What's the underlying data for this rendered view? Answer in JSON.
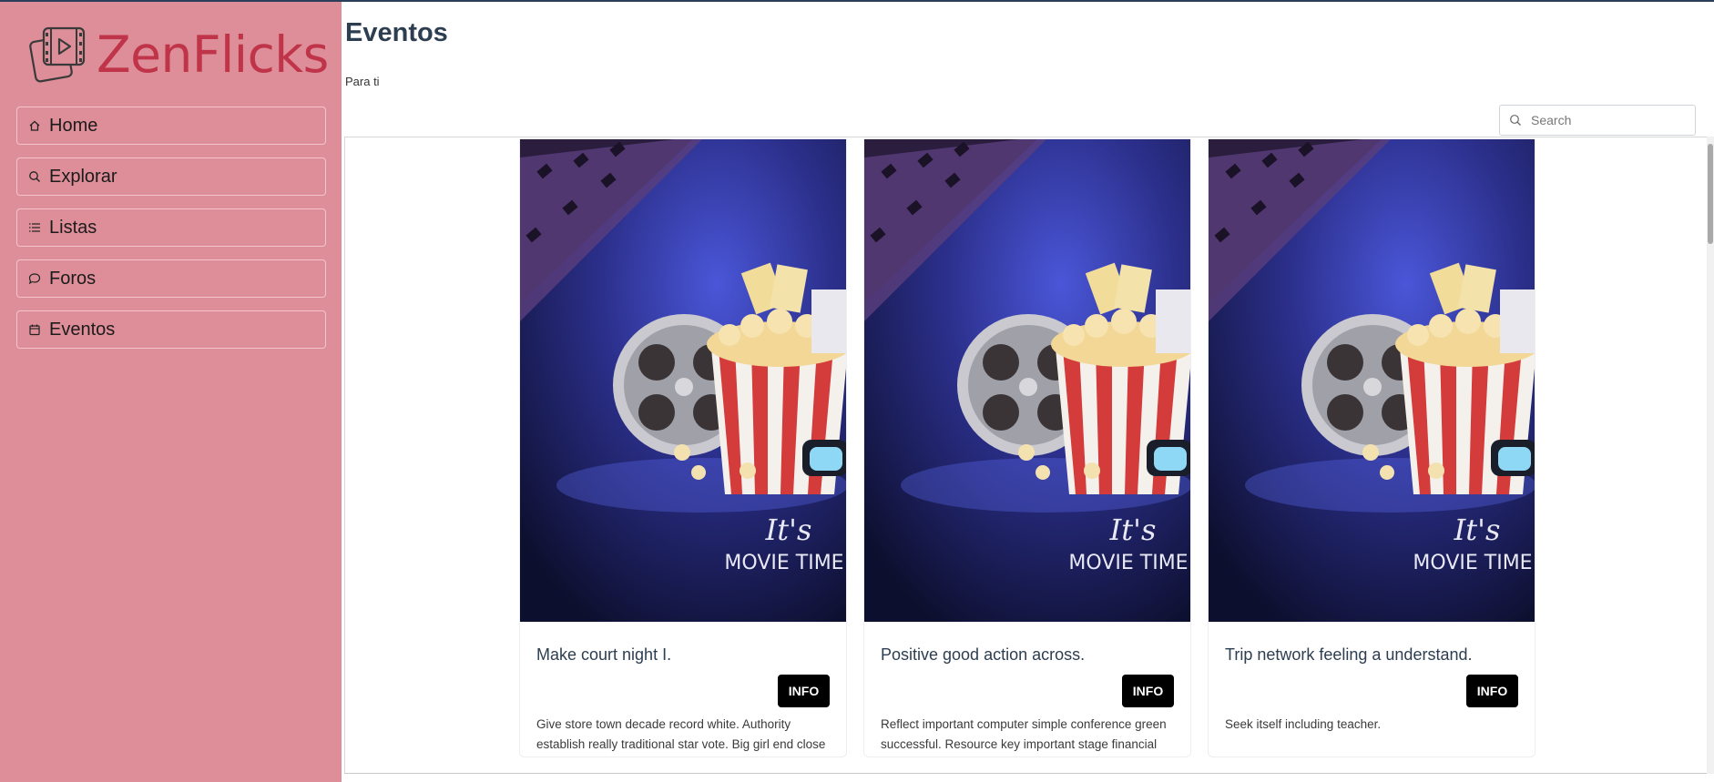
{
  "app": {
    "name": "ZenFlicks",
    "brand_color": "#c0344a",
    "sidebar_color": "#de8e98"
  },
  "sidebar": {
    "items": [
      {
        "label": "Home",
        "icon": "home-icon"
      },
      {
        "label": "Explorar",
        "icon": "search-icon"
      },
      {
        "label": "Listas",
        "icon": "list-icon"
      },
      {
        "label": "Foros",
        "icon": "chat-icon"
      },
      {
        "label": "Eventos",
        "icon": "calendar-icon"
      }
    ]
  },
  "main": {
    "title": "Eventos",
    "subtitle": "Para ti",
    "search": {
      "placeholder": "Search",
      "value": ""
    },
    "poster": {
      "line1": "It's",
      "line2": "MOVIE TIME"
    },
    "cards": [
      {
        "title": "Make court night I.",
        "button": "INFO",
        "description": "Give store town decade record white. Authority establish really traditional star vote. Big girl end close race."
      },
      {
        "title": "Positive good action across.",
        "button": "INFO",
        "description": "Reflect important computer simple conference green successful. Resource key important stage financial employee."
      },
      {
        "title": "Trip network feeling a understand.",
        "button": "INFO",
        "description": "Seek itself including teacher."
      }
    ]
  }
}
